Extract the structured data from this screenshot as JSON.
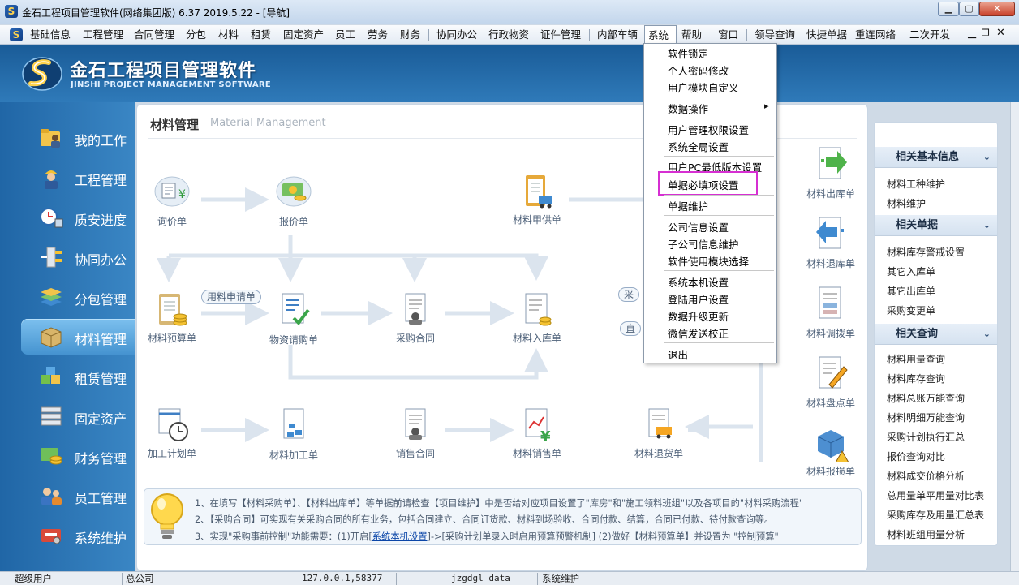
{
  "window": {
    "title": "金石工程项目管理软件(网络集团版) 6.37  2019.5.22 - [导航]"
  },
  "menubar": {
    "items": [
      "基础信息",
      "工程管理",
      "合同管理",
      "分包",
      "材料",
      "租赁",
      "固定资产",
      "员工",
      "劳务",
      "财务",
      "协同办公",
      "行政物资",
      "证件管理",
      "内部车辆",
      "系统",
      "帮助",
      "窗口",
      "领导查询",
      "快捷单据",
      "重连网络",
      "二次开发"
    ],
    "active": "系统"
  },
  "header": {
    "logo_cn": "金石工程项目管理软件",
    "logo_en": "JINSHI PROJECT MANAGEMENT SOFTWARE"
  },
  "sidebar": {
    "items": [
      {
        "label": "我的工作",
        "icon": "folder-person-icon"
      },
      {
        "label": "工程管理",
        "icon": "worker-icon"
      },
      {
        "label": "质安进度",
        "icon": "clock-icon"
      },
      {
        "label": "协同办公",
        "icon": "network-icon"
      },
      {
        "label": "分包管理",
        "icon": "layers-icon"
      },
      {
        "label": "材料管理",
        "icon": "box-icon",
        "active": true
      },
      {
        "label": "租赁管理",
        "icon": "cubes-icon"
      },
      {
        "label": "固定资产",
        "icon": "server-icon"
      },
      {
        "label": "财务管理",
        "icon": "coins-icon"
      },
      {
        "label": "员工管理",
        "icon": "people-icon"
      },
      {
        "label": "系统维护",
        "icon": "tools-icon"
      }
    ]
  },
  "main": {
    "title_cn": "材料管理",
    "title_en": "Material Management",
    "flow": {
      "inquiry": "询价单",
      "quote": "报价单",
      "owner_supply": "材料甲供单",
      "budget": "材料预算单",
      "apply_pill": "用料申请单",
      "purchase_request": "物资请购单",
      "purchase_contract": "采购合同",
      "inbound": "材料入库单",
      "pill_cai": "采",
      "pill_zhi": "直",
      "plan": "加工计划单",
      "processing": "材料加工单",
      "sales_contract": "销售合同",
      "sales": "材料销售单",
      "return_goods": "材料退货单",
      "outbound": "材料出库单",
      "return_inbound": "材料退库单",
      "transfer": "材料调拨单",
      "inventory": "材料盘点单",
      "loss": "材料报损单"
    },
    "tips": {
      "line1": "1、在填写【材料采购单】、【材料出库单】等单据前请检查【项目维护】中是否给对应项目设置了\"库房\"和\"施工领料班组\"以及各项目的\"材料采购流程\"",
      "line2": "2、【采购合同】可实现有关采购合同的所有业务，包括合同建立、合同订货款、材料到场验收、合同付款、结算，合同已付款、待付款查询等。",
      "line3_a": "3、实现\"采购事前控制\"功能需要：(1)开启[",
      "line3_link": "系统本机设置",
      "line3_b": "]->[采购计划单录入时启用预算预警机制]  (2)做好【材料预算单】并设置为 \"控制预算\""
    }
  },
  "rightpanel": {
    "sections": [
      {
        "title": "相关基本信息",
        "items": [
          "材料工种维护",
          "材料维护"
        ]
      },
      {
        "title": "相关单据",
        "items": [
          "材料库存警戒设置",
          "其它入库单",
          "其它出库单",
          "采购变更单"
        ]
      },
      {
        "title": "相关查询",
        "items": [
          "材料用量查询",
          "材料库存查询",
          "材料总账万能查询",
          "材料明细万能查询",
          "采购计划执行汇总",
          "报价查询对比",
          "材料成交价格分析",
          "总用量单平用量对比表",
          "采购库存及用量汇总表",
          "材料班组用量分析"
        ]
      }
    ]
  },
  "dropdown": {
    "items": [
      "软件锁定",
      "个人密码修改",
      "用户模块自定义",
      "数据操作",
      "用户管理权限设置",
      "系统全局设置",
      "用户PC最低版本设置",
      "单据必填项设置",
      "单据维护",
      "公司信息设置",
      "子公司信息维护",
      "软件使用模块选择",
      "系统本机设置",
      "登陆用户设置",
      "数据升级更新",
      "微信发送校正",
      "退出"
    ],
    "submenu_arrow": "▸"
  },
  "statusbar": {
    "user": "超级用户",
    "company": "总公司",
    "server": "127.0.0.1,58377",
    "db": "jzgdgl_data",
    "module": "系统维护"
  },
  "colors": {
    "accent": "#2f7ab9",
    "highlight": "#d62fd2",
    "sidebar_active": "#5aa6de"
  }
}
